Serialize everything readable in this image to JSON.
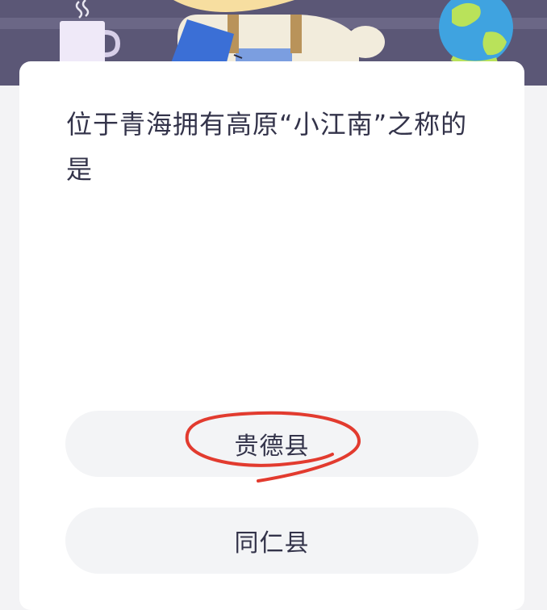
{
  "quiz": {
    "question": "位于青海拥有高原“小江南”之称的是",
    "options": [
      {
        "label": "贵德县"
      },
      {
        "label": "同仁县"
      }
    ]
  },
  "colors": {
    "banner": "#5b5776",
    "card": "#ffffff",
    "option_bg": "#f3f4f6",
    "text": "#33334a",
    "annotation": "#e23b2f"
  },
  "icons": [
    "coffee-mug-icon",
    "globe-icon",
    "cartoon-mascot"
  ]
}
